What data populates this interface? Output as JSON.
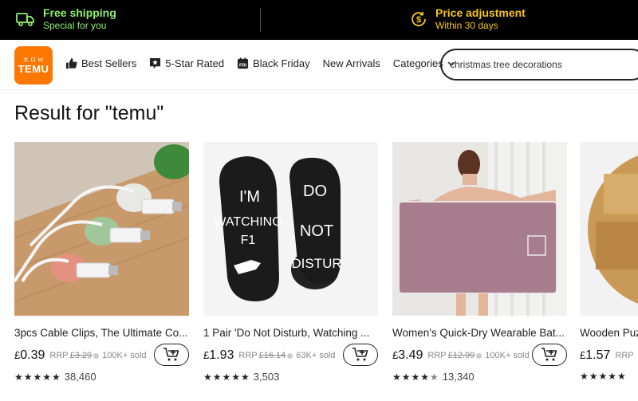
{
  "promo": {
    "left": {
      "title": "Free shipping",
      "subtitle": "Special for you",
      "icon": "truck-icon"
    },
    "right": {
      "title": "Price adjustment",
      "subtitle": "Within 30 days",
      "icon": "dollar-refresh-icon"
    }
  },
  "header": {
    "logo_glyphs": "ㅊㅁㅂ",
    "logo_word": "TEMU",
    "nav": [
      {
        "label": "Best Sellers",
        "icon": "thumbs-up-icon"
      },
      {
        "label": "5-Star Rated",
        "icon": "star-badge-icon"
      },
      {
        "label": "Black Friday",
        "icon": "calendar-fri-icon"
      },
      {
        "label": "New Arrivals",
        "icon": ""
      },
      {
        "label": "Categories",
        "icon": "chevron-down-icon"
      }
    ],
    "search_value": "christmas tree decorations"
  },
  "result_title": "Result for \"temu\"",
  "products": [
    {
      "title": "3pcs Cable Clips, The Ultimate Co...",
      "currency": "£",
      "price": "0.39",
      "rrp_label": "RRP",
      "rrp": "£3.29",
      "sold": "100K+ sold",
      "rating": 5,
      "reviews": "38,460"
    },
    {
      "title": "1 Pair 'Do Not Disturb, Watching ...",
      "currency": "£",
      "price": "1.93",
      "rrp_label": "RRP",
      "rrp": "£16.14",
      "sold": "63K+ sold",
      "rating": 5,
      "reviews": "3,503",
      "sock_left": [
        "I'M",
        "WATCHING",
        "F1"
      ],
      "sock_right": [
        "DO",
        "NOT",
        "DISTUR"
      ]
    },
    {
      "title": "Women's Quick-Dry Wearable Bat...",
      "currency": "£",
      "price": "3.49",
      "rrp_label": "RRP",
      "rrp": "£12.99",
      "sold": "100K+ sold",
      "rating": 4.5,
      "reviews": "13,340"
    },
    {
      "title": "Wooden Puz",
      "currency": "£",
      "price": "1.57",
      "rrp_label": "RRP",
      "rrp": "",
      "sold": "",
      "rating": 5,
      "reviews": ""
    }
  ],
  "colors": {
    "brand": "#fb7701",
    "promo_green": "#8ef16e",
    "promo_gold": "#f5c518"
  }
}
